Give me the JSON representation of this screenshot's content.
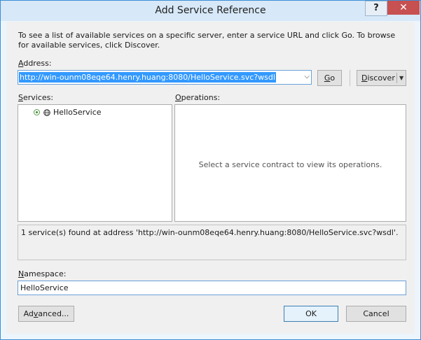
{
  "window": {
    "title": "Add Service Reference",
    "help_label": "?",
    "close_label": "✕"
  },
  "intro_text": "To see a list of available services on a specific server, enter a service URL and click Go. To browse for available services, click Discover.",
  "address": {
    "label_key": "A",
    "label_rest": "ddress:",
    "value": "http://win-ounm08eqe64.henry.huang:8080/HelloService.svc?wsdl"
  },
  "buttons": {
    "go_key": "G",
    "go_rest": "o",
    "discover_key": "D",
    "discover_rest": "iscover",
    "advanced_pre": "Ad",
    "advanced_key": "v",
    "advanced_rest": "anced...",
    "ok": "OK",
    "cancel": "Cancel"
  },
  "services": {
    "label_key": "S",
    "label_rest": "ervices:",
    "items": [
      {
        "label": "HelloService"
      }
    ]
  },
  "operations": {
    "label_key": "O",
    "label_rest": "perations:",
    "empty_message": "Select a service contract to view its operations."
  },
  "status_text": "1 service(s) found at address 'http://win-ounm08eqe64.henry.huang:8080/HelloService.svc?wsdl'.",
  "namespace": {
    "label_key": "N",
    "label_rest": "amespace:",
    "value": "HelloService"
  }
}
